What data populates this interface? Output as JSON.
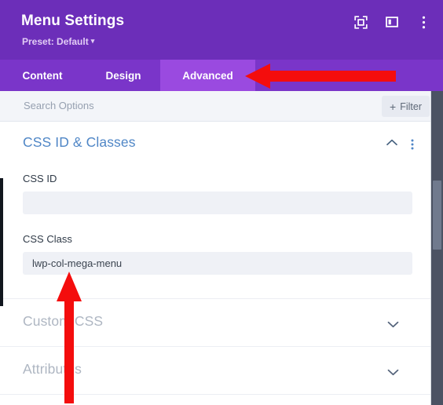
{
  "header": {
    "title": "Menu Settings",
    "preset_label": "Preset: Default",
    "preset_caret": "▾",
    "icons": [
      {
        "name": "focus-view-icon",
        "label": "Focus view"
      },
      {
        "name": "panel-layout-icon",
        "label": "Change panel layout"
      },
      {
        "name": "more-options-icon",
        "label": "More options"
      }
    ],
    "background_color": "#6c2eb9"
  },
  "tabs": {
    "background_color": "#7a35c9",
    "active_color": "#9a4ae0",
    "active": "Advanced",
    "items": [
      {
        "label": "Content",
        "active": false
      },
      {
        "label": "Design",
        "active": false
      },
      {
        "label": "Advanced",
        "active": true
      }
    ]
  },
  "search": {
    "placeholder": "Search Options",
    "value": "",
    "filter_label": "Filter",
    "filter_plus": "+"
  },
  "sections": {
    "open": {
      "title": "CSS ID & Classes",
      "title_color": "#4f86c6",
      "expanded": true,
      "collapse_icon": "chevron-up-icon",
      "menu_icon": "vertical-dots-icon",
      "fields": [
        {
          "label": "CSS ID",
          "value": "",
          "placeholder": ""
        },
        {
          "label": "CSS Class",
          "value": "lwp-col-mega-menu",
          "placeholder": ""
        }
      ]
    },
    "collapsed": [
      {
        "title": "Custom CSS",
        "expand_icon": "chevron-down-icon"
      },
      {
        "title": "Attributes",
        "expand_icon": "chevron-down-icon"
      }
    ]
  },
  "annotations": {
    "color": "#f40d0d",
    "arrows": [
      {
        "name": "arrow-pointing-to-advanced-tab",
        "direction": "left"
      },
      {
        "name": "arrow-pointing-to-css-class-field",
        "direction": "up"
      }
    ]
  }
}
